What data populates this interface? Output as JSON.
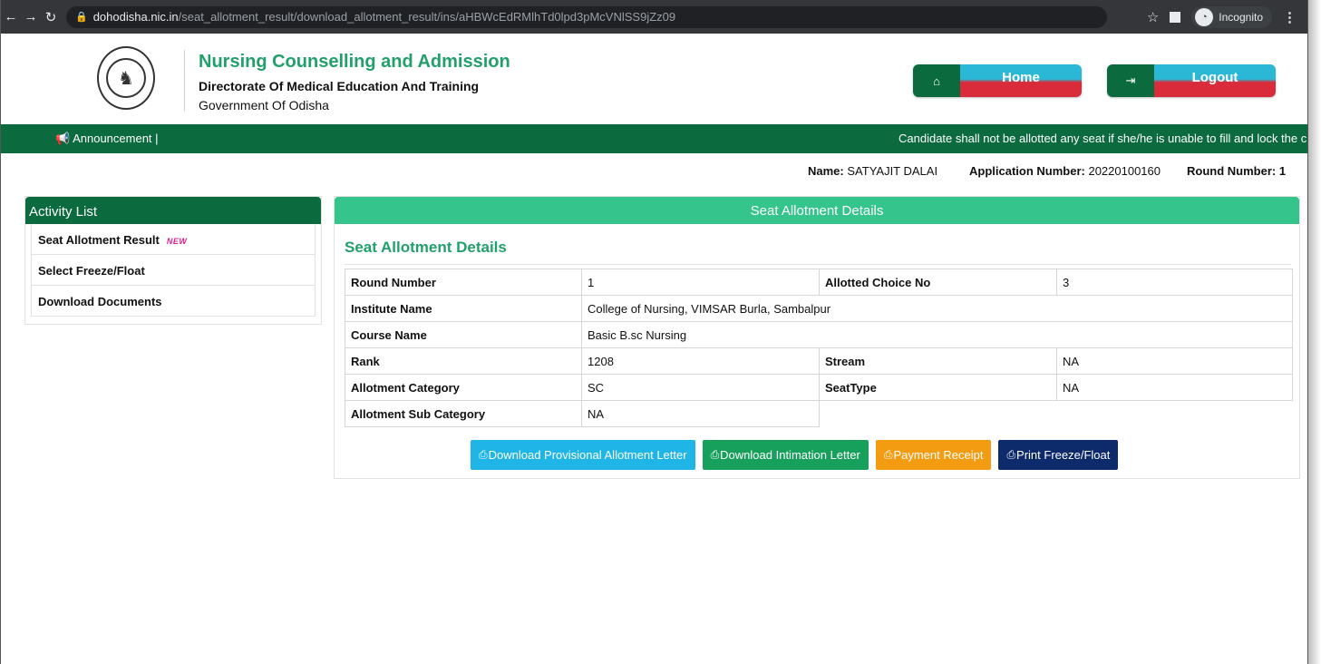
{
  "browser": {
    "url_host": "dohodisha.nic.in",
    "url_path": "/seat_allotment_result/download_allotment_result/ins/aHBWcEdRMlhTd0lpd3pMcVNlSS9jZz09",
    "incognito_label": "Incognito"
  },
  "header": {
    "title": "Nursing Counselling and Admission",
    "subtitle": "Directorate Of Medical Education And Training",
    "subtitle2": "Government Of Odisha",
    "home_label": "Home",
    "logout_label": "Logout"
  },
  "announcement": {
    "label": "Announcement  |",
    "text": "Candidate shall not be allotted any seat if she/he is unable to fill and lock the c"
  },
  "user": {
    "name_label": "Name:",
    "name": "SATYAJIT DALAI",
    "app_label": "Application Number:",
    "app_number": "20220100160",
    "round_label": "Round Number: 1"
  },
  "sidebar": {
    "title": "Activity List",
    "items": [
      {
        "label": "Seat Allotment Result",
        "badge": "NEW"
      },
      {
        "label": "Select Freeze/Float"
      },
      {
        "label": "Download Documents"
      }
    ]
  },
  "panel": {
    "header": "Seat Allotment Details",
    "title": "Seat Allotment Details",
    "rows": {
      "round_number": {
        "label": "Round Number",
        "value": "1"
      },
      "allotted_choice": {
        "label": "Allotted Choice No",
        "value": "3"
      },
      "institute": {
        "label": "Institute Name",
        "value": "College of Nursing, VIMSAR Burla, Sambalpur"
      },
      "course": {
        "label": "Course Name",
        "value": "Basic B.sc Nursing"
      },
      "rank": {
        "label": "Rank",
        "value": "1208"
      },
      "stream": {
        "label": "Stream",
        "value": "NA"
      },
      "category": {
        "label": "Allotment Category",
        "value": "SC"
      },
      "seat_type": {
        "label": "SeatType",
        "value": "NA"
      },
      "sub_category": {
        "label": "Allotment Sub Category",
        "value": "NA"
      }
    },
    "buttons": {
      "provisional": "Download Provisional Allotment Letter",
      "intimation": "Download Intimation Letter",
      "payment": "Payment Receipt",
      "freeze": "Print Freeze/Float"
    }
  },
  "colors": {
    "brand_green": "#0b6b3f",
    "accent_green": "#34c48c",
    "title_green": "#22a06b"
  }
}
